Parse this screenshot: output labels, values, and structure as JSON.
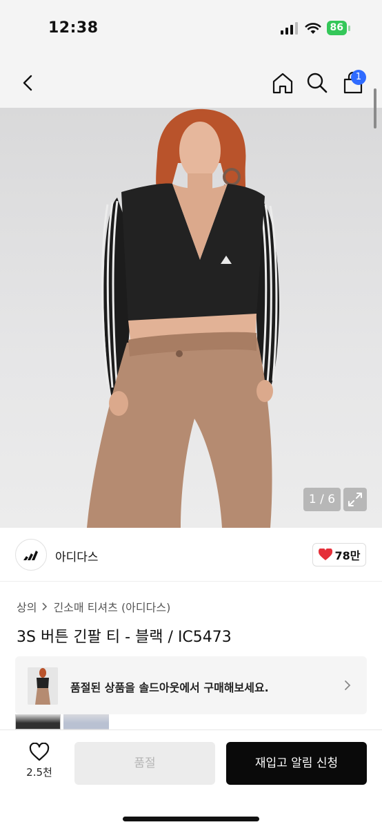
{
  "status_bar": {
    "time": "12:38",
    "battery": "86"
  },
  "nav": {
    "cart_count": "1"
  },
  "gallery": {
    "counter": "1 / 6"
  },
  "brand": {
    "name": "아디다스",
    "likes": "78만"
  },
  "breadcrumb": {
    "level1": "상의",
    "level2": "긴소매 티셔츠 (아디다스)"
  },
  "product": {
    "title": "3S 버튼 긴팔 티 - 블랙 / IC5473"
  },
  "soldout_banner": {
    "text": "품절된 상품을 솔드아웃에서 구매해보세요."
  },
  "bottom_bar": {
    "wish_count": "2.5천",
    "soldout_label": "품절",
    "restock_label": "재입고 알림 신청"
  },
  "colors": {
    "accent_badge": "#2f6bff",
    "primary_button": "#0a0a0a",
    "heart": "#e5303a"
  }
}
